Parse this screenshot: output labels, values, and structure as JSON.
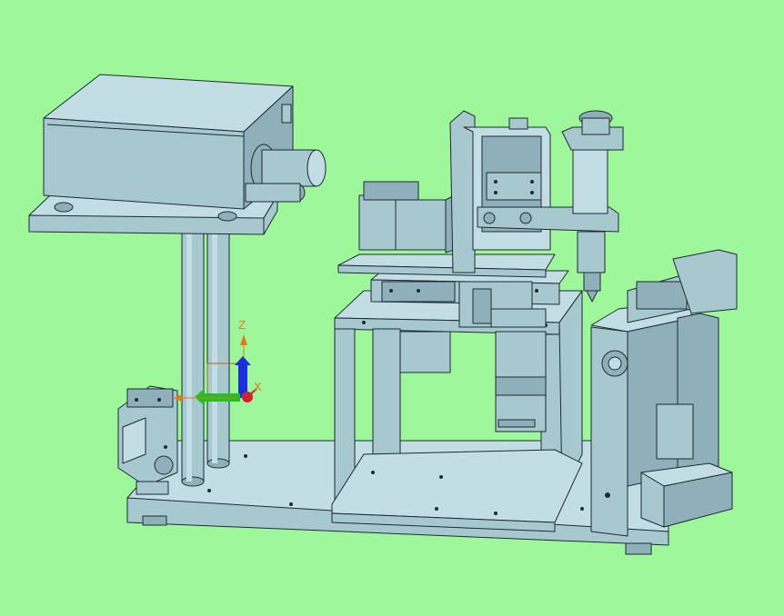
{
  "viewport": {
    "background": "#9ef79b",
    "part_fill": "#a8c8d0",
    "part_dark": "#8fb0ba",
    "part_light": "#c2dde3",
    "edge_color": "#1e2a30"
  },
  "triad": {
    "z_label": "Z",
    "x_label": "X",
    "label_color": "#e07a1a",
    "z_axis_color": "#1a2fd8",
    "y_axis_color": "#22c025",
    "origin_color": "#d4202a"
  }
}
